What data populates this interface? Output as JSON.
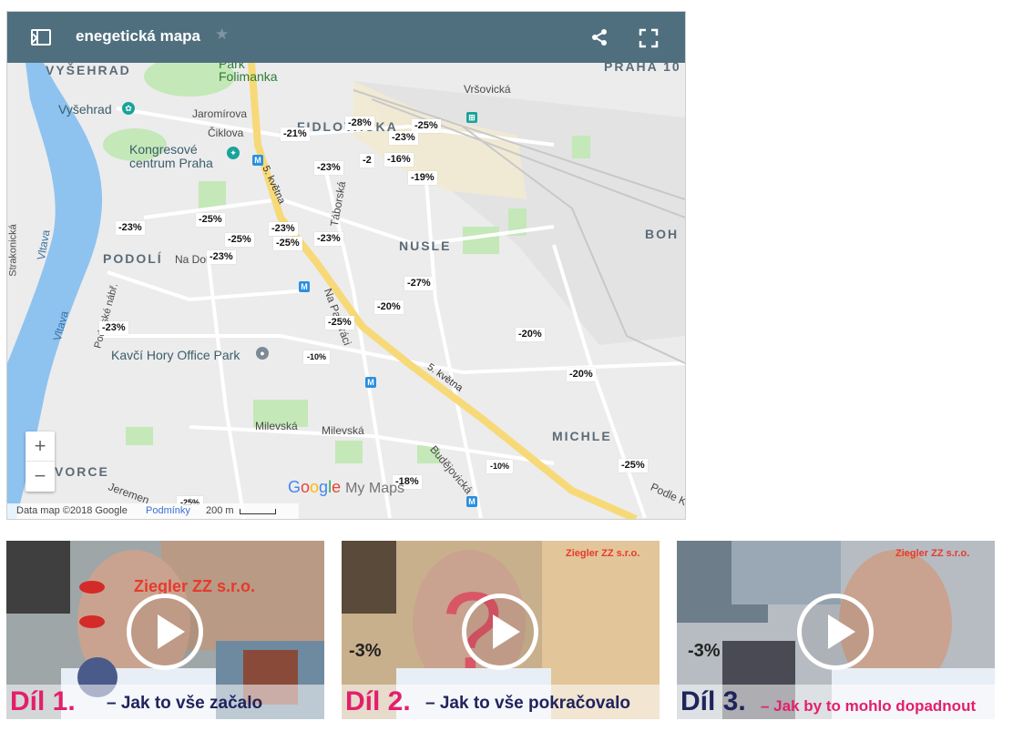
{
  "map": {
    "title": "enegetická mapa",
    "places": [
      "VYŠEHRAD",
      "PRAHA 10",
      "FIDLOVAČKA",
      "NUSLE",
      "PODOLÍ",
      "MICHLE",
      "BOH",
      "VORCE"
    ],
    "pois": [
      "Vyšehrad",
      "Kongresové centrum Praha",
      "Kavčí Hory Office Park"
    ],
    "park": "Park Folimanka",
    "labels": [
      "Jaromírova",
      "Čiklova",
      "Vršovická",
      "Táborská",
      "Na Dol",
      "Na Pankráci",
      "Milevská",
      "Milevská",
      "Budějovická",
      "Strakonická",
      "Vltava",
      "Vltava",
      "Podolské nábř.",
      "5. května",
      "5. května",
      "Jeremen",
      "Podle K"
    ],
    "percent_labels": [
      "-28%",
      "-25%",
      "-21%",
      "-23%",
      "-23%",
      "-2",
      "-16%",
      "-19%",
      "-23%",
      "-25%",
      "-23%",
      "-25%",
      "-25%",
      "-23%",
      "-23%",
      "-27%",
      "-20%",
      "-25%",
      "-23%",
      "-20%",
      "-10%",
      "-20%",
      "-25%",
      "-18%",
      "-10%",
      "-25%"
    ],
    "zoom_in": "+",
    "zoom_out": "−",
    "logo_google": "Google",
    "logo_mymaps": "My Maps",
    "attribution": "Data map ©2018 Google",
    "terms": "Podmínky",
    "scale": "200 m",
    "colors": {
      "header": "#4f6f7e",
      "water": "#8ec3f0",
      "park": "#c4e8b8",
      "road": "#f7d978"
    }
  },
  "videos": [
    {
      "part": "Díl 1.",
      "subtitle": "– Jak to vše začalo",
      "overlay_text": "Ziegler ZZ s.r.o.",
      "part_color": "#e31f6c",
      "sub_color": "#20245c"
    },
    {
      "part": "Díl 2.",
      "subtitle": "– Jak to vše pokračovalo",
      "overlay_text": "Ziegler ZZ s.r.o.",
      "side_text": "-3%",
      "part_color": "#e31f6c",
      "sub_color": "#20245c"
    },
    {
      "part": "Díl 3.",
      "subtitle": "– Jak by to mohlo dopadnout",
      "overlay_text": "Ziegler ZZ s.r.o.",
      "side_text": "-3%",
      "part_color": "#20245c",
      "sub_color": "#e31f6c"
    }
  ]
}
